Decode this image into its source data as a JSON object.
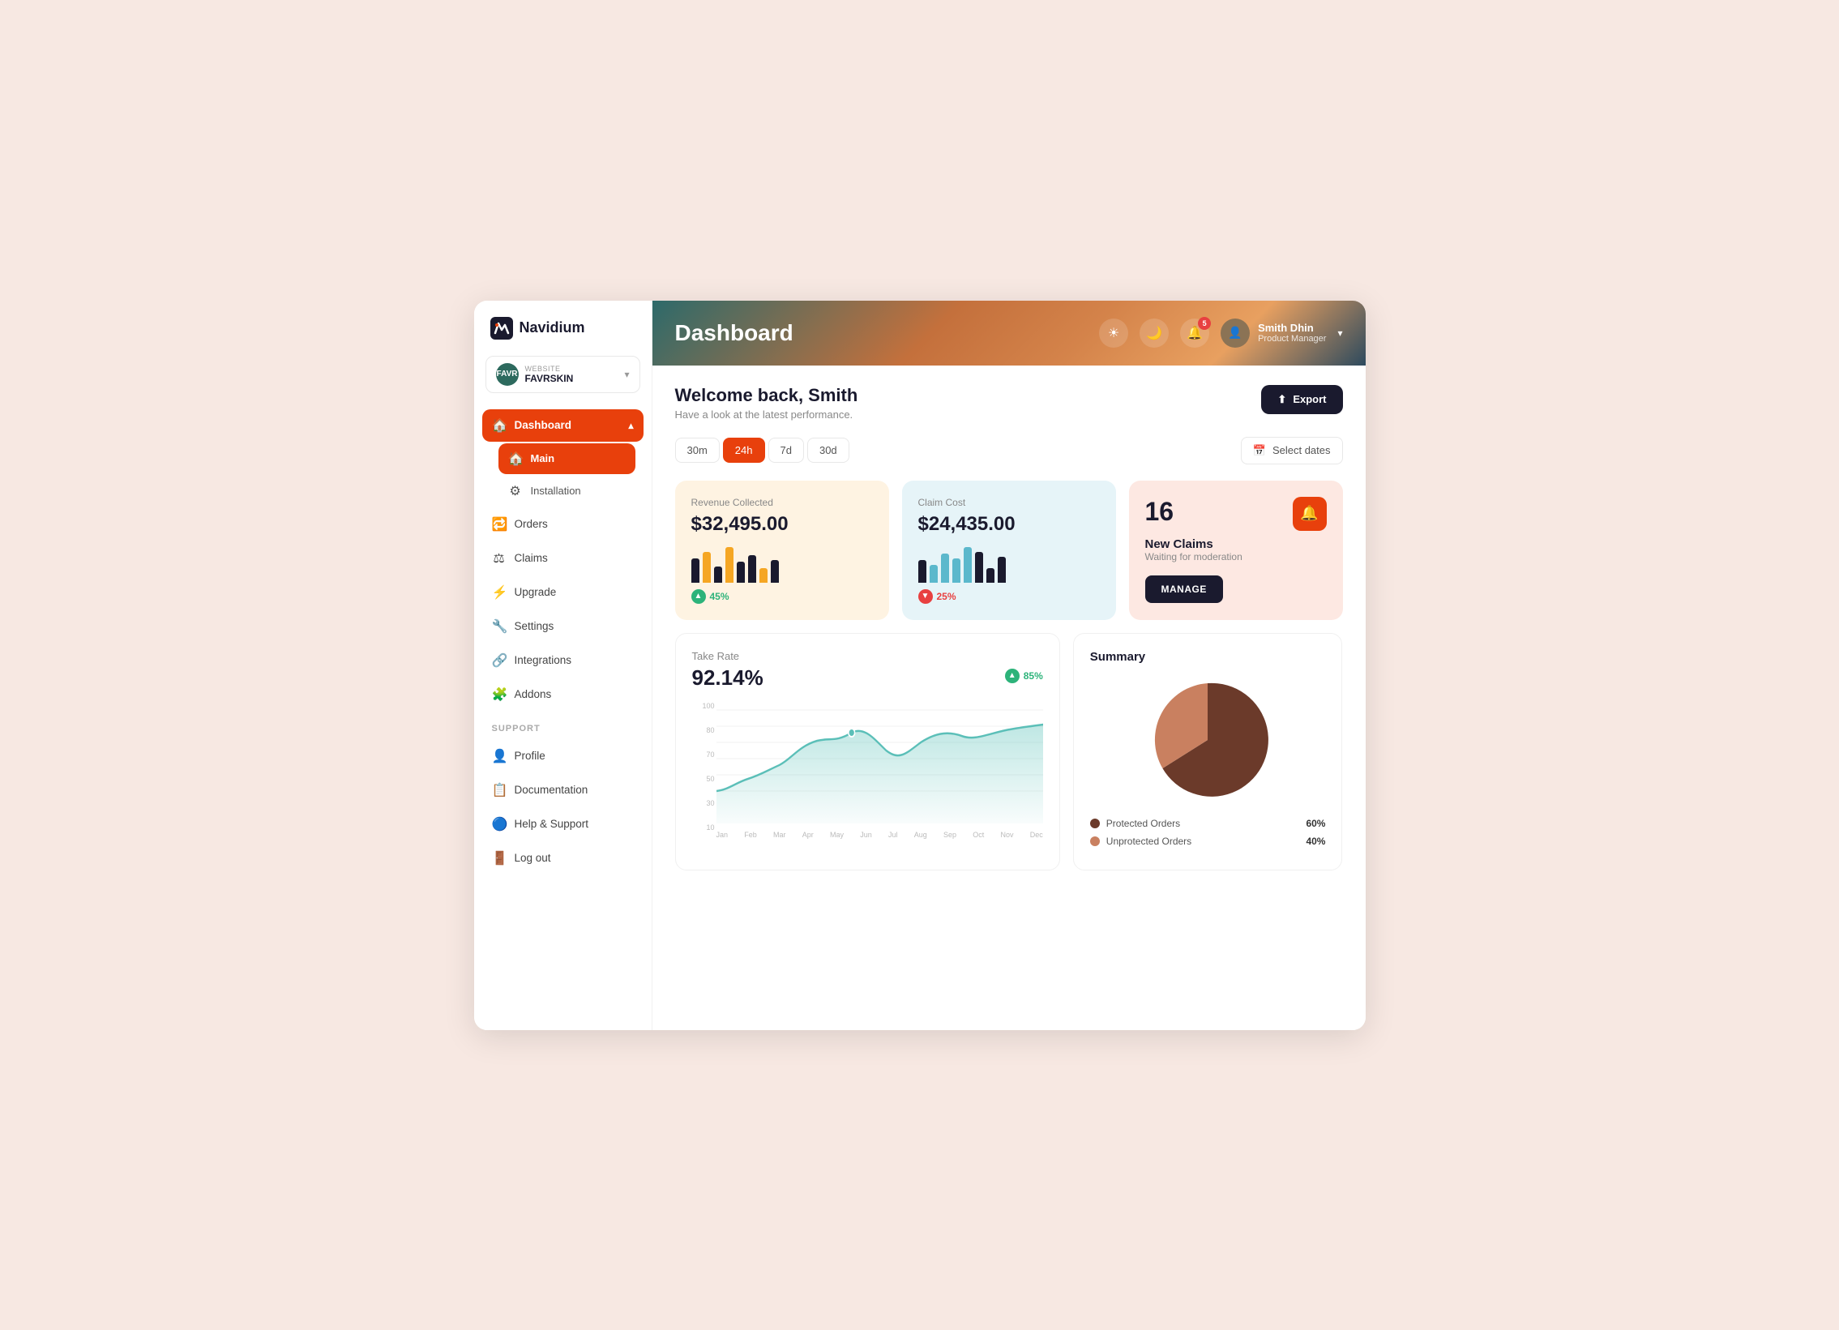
{
  "app": {
    "name": "Navidium"
  },
  "sidebar": {
    "website_label": "WEBSITE",
    "website_name": "FAVRSKIN",
    "website_avatar": "FAVR",
    "nav": [
      {
        "id": "dashboard",
        "label": "Dashboard",
        "icon": "🏠",
        "active": true,
        "expandable": true
      },
      {
        "id": "main",
        "label": "Main",
        "icon": "🏠",
        "active": true,
        "sub": true
      },
      {
        "id": "installation",
        "label": "Installation",
        "icon": "⚙",
        "sub": true
      },
      {
        "id": "orders",
        "label": "Orders",
        "icon": "🔁"
      },
      {
        "id": "claims",
        "label": "Claims",
        "icon": "⚖"
      },
      {
        "id": "upgrade",
        "label": "Upgrade",
        "icon": "⚡"
      },
      {
        "id": "settings",
        "label": "Settings",
        "icon": "🔧"
      },
      {
        "id": "integrations",
        "label": "Integrations",
        "icon": "🔗"
      },
      {
        "id": "addons",
        "label": "Addons",
        "icon": "🧩"
      }
    ],
    "support_label": "SUPPORT",
    "support_nav": [
      {
        "id": "profile",
        "label": "Profile",
        "icon": "👤"
      },
      {
        "id": "documentation",
        "label": "Documentation",
        "icon": "📋"
      },
      {
        "id": "help",
        "label": "Help & Support",
        "icon": "🔵"
      },
      {
        "id": "logout",
        "label": "Log out",
        "icon": "🚪"
      }
    ]
  },
  "header": {
    "title": "Dashboard",
    "notification_count": "5",
    "user_name": "Smith Dhin",
    "user_role": "Product Manager"
  },
  "dashboard": {
    "welcome": "Welcome back, Smith",
    "subtitle": "Have a look at the latest performance.",
    "export_label": "Export",
    "time_filters": [
      "30m",
      "24h",
      "7d",
      "30d"
    ],
    "active_filter": "24h",
    "date_placeholder": "Select dates",
    "stats": {
      "revenue": {
        "label": "Revenue Collected",
        "value": "$32,495.00",
        "trend": "45%",
        "trend_dir": "up"
      },
      "claim_cost": {
        "label": "Claim Cost",
        "value": "$24,435.00",
        "trend": "25%",
        "trend_dir": "down"
      },
      "new_claims": {
        "number": "16",
        "title": "New Claims",
        "subtitle": "Waiting for moderation",
        "manage_label": "MANAGE"
      }
    },
    "take_rate": {
      "label": "Take Rate",
      "value": "92.14%",
      "trend": "85%",
      "trend_dir": "up"
    },
    "x_labels": [
      "Jan",
      "Feb",
      "Mar",
      "Apr",
      "May",
      "Jun",
      "Jul",
      "Aug",
      "Sep",
      "Oct",
      "Nov",
      "Dec"
    ],
    "y_labels": [
      "100",
      "80",
      "70",
      "50",
      "30",
      "10"
    ],
    "summary": {
      "title": "Summary",
      "legend": [
        {
          "label": "Protected Orders",
          "pct": "60%",
          "color": "#6b3a2a"
        },
        {
          "label": "Unprotected Orders",
          "pct": "40%",
          "color": "#c98060"
        }
      ]
    }
  }
}
